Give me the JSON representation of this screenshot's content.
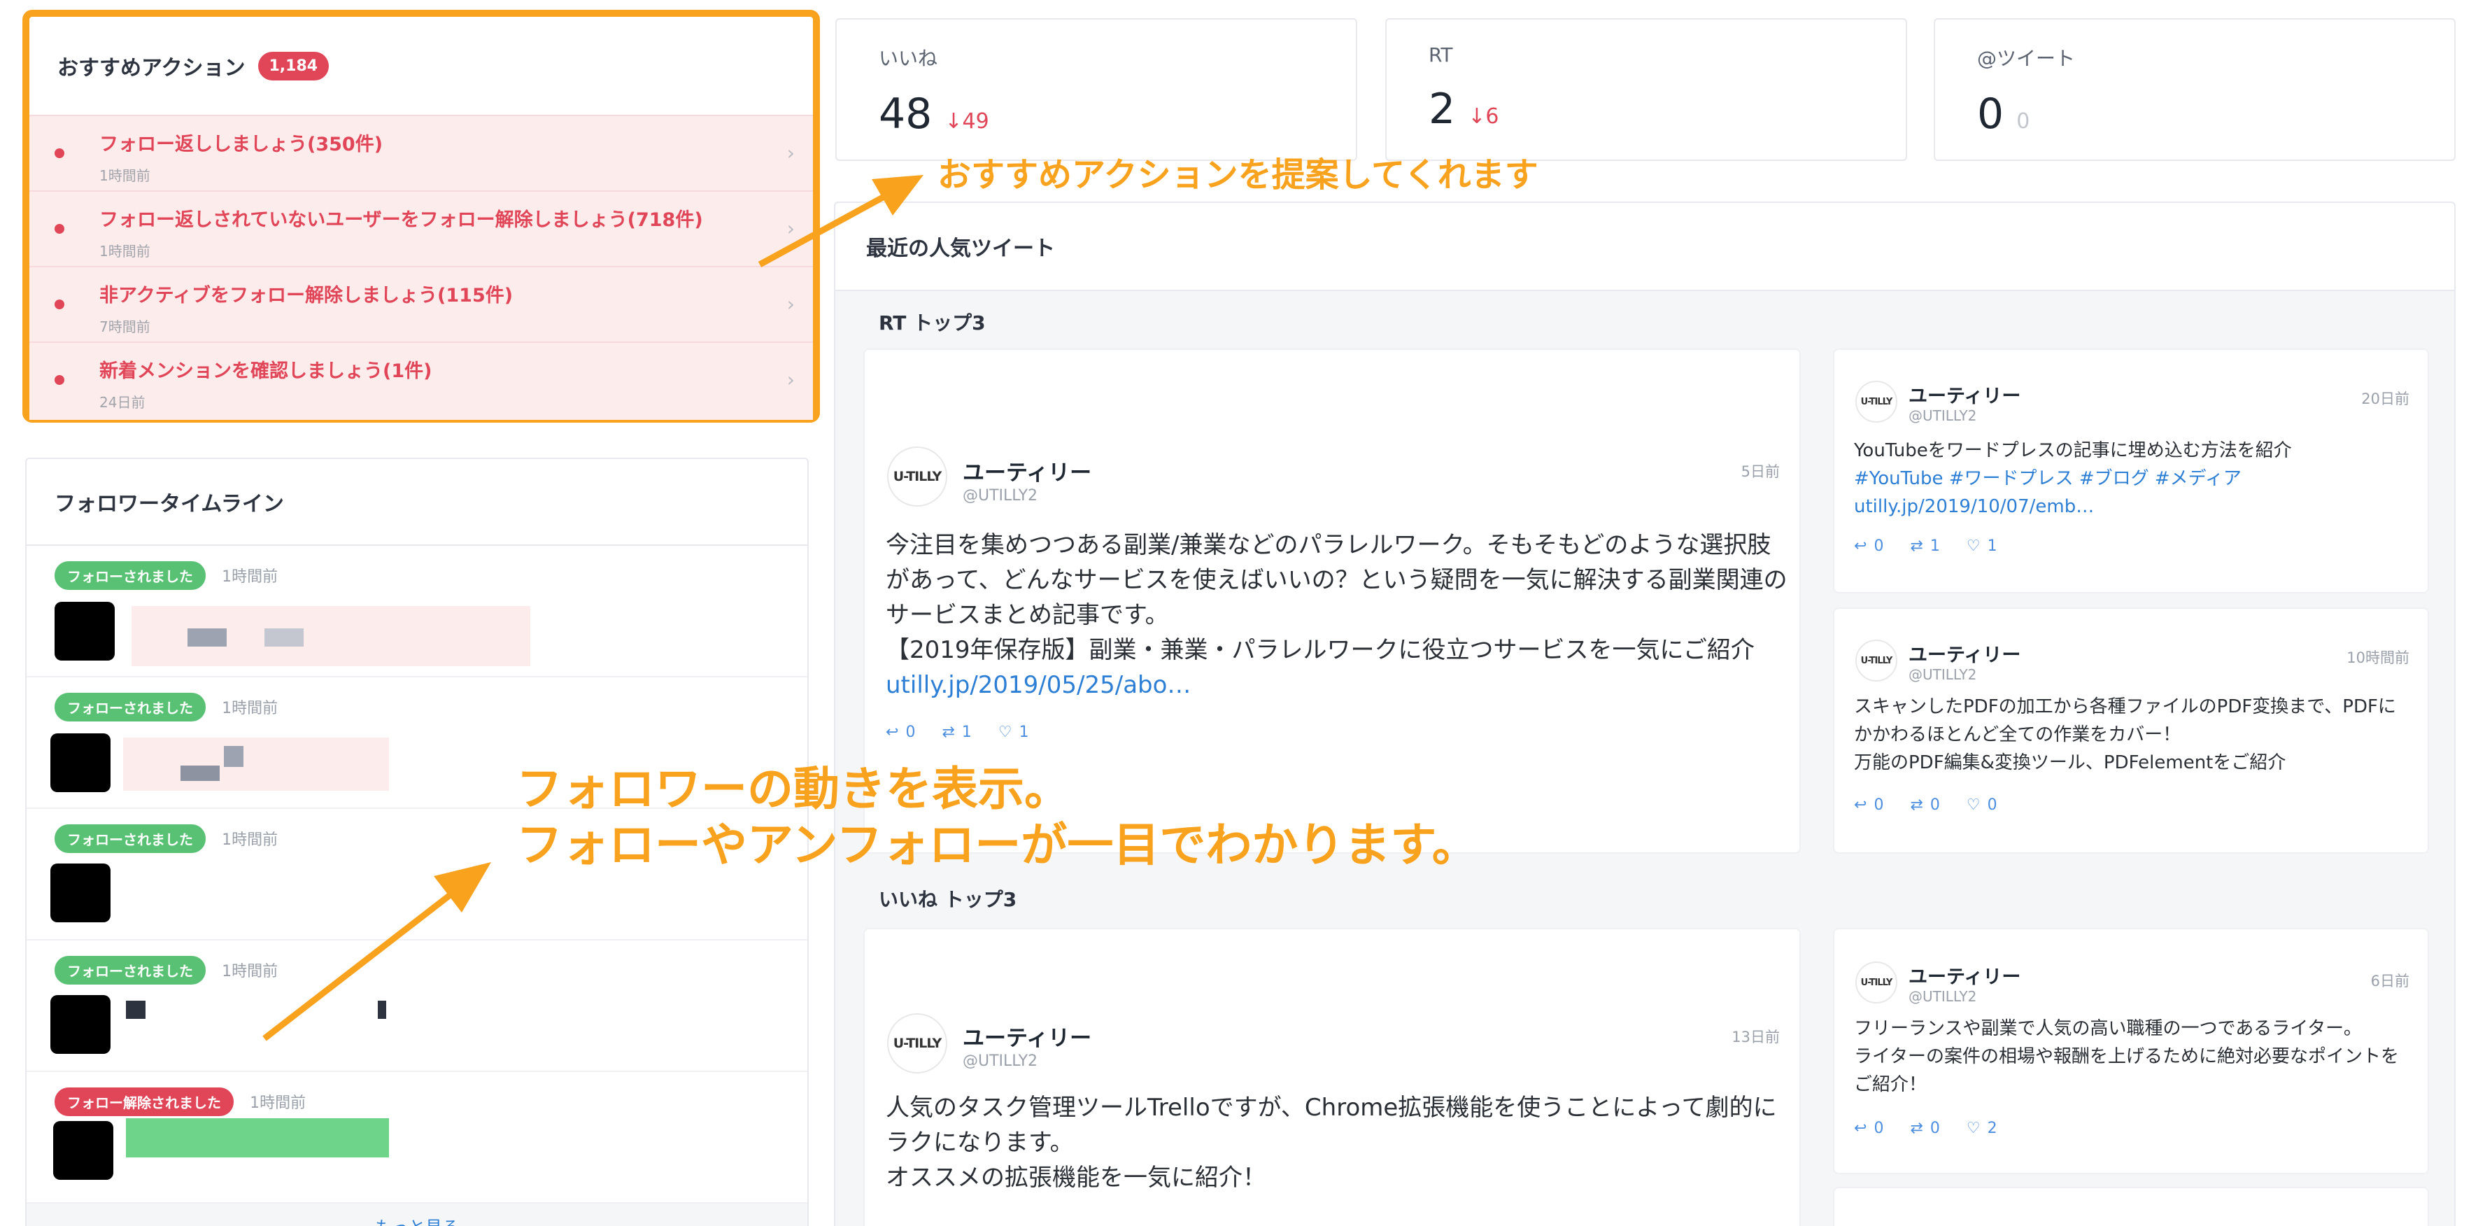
{
  "recommended": {
    "title": "おすすめアクション",
    "count": "1,184",
    "items": [
      {
        "label": "フォロー返ししましょう(350件)",
        "time": "1時間前"
      },
      {
        "label": "フォロー返しされていないユーザーをフォロー解除しましょう(718件)",
        "time": "1時間前"
      },
      {
        "label": "非アクティブをフォロー解除しましょう(115件)",
        "time": "7時間前"
      },
      {
        "label": "新着メンションを確認しましょう(1件)",
        "time": "24日前"
      }
    ]
  },
  "timeline": {
    "title": "フォロワータイムライン",
    "items": [
      {
        "tag": "フォローされました",
        "time": "1時間前"
      },
      {
        "tag": "フォローされました",
        "time": "1時間前"
      },
      {
        "tag": "フォローされました",
        "time": "1時間前"
      },
      {
        "tag": "フォローされました",
        "time": "1時間前"
      },
      {
        "tag": "フォロー解除されました",
        "time": "1時間前"
      }
    ],
    "more": "もっと見る"
  },
  "stats": [
    {
      "label": "いいね",
      "value": "48",
      "delta": "↓49"
    },
    {
      "label": "RT",
      "value": "2",
      "delta": "↓6"
    },
    {
      "label": "@ツイート",
      "value": "0",
      "delta": "0"
    }
  ],
  "popular": {
    "title": "最近の人気ツイート",
    "rt_top": "RT トップ3",
    "like_top": "いいね トップ3",
    "logo": "U-TILLY",
    "tweets": [
      {
        "name": "ユーティリー",
        "handle": "@UTILLY2",
        "date": "5日前",
        "text": "今注目を集めつつある副業/兼業などのパラレルワーク。そもそもどのような選択肢があって、どんなサービスを使えばいいの？という疑問を一気に解決する副業関連のサービスまとめ記事です。\n【2019年保存版】副業・兼業・パラレルワークに役立つサービスを一気にご紹介 ",
        "link": "utilly.jp/2019/05/25/abo…",
        "reply": "0",
        "rt": "1",
        "like": "1"
      },
      {
        "name": "ユーティリー",
        "handle": "@UTILLY2",
        "date": "20日前",
        "text": "YouTubeをワードプレスの記事に埋め込む方法を紹介",
        "link": "#YouTube #ワードプレス #ブログ #メディア\nutilly.jp/2019/10/07/emb…",
        "reply": "0",
        "rt": "1",
        "like": "1"
      },
      {
        "name": "ユーティリー",
        "handle": "@UTILLY2",
        "date": "10時間前",
        "text": "スキャンしたPDFの加工から各種ファイルのPDF変換まで、PDFにかかわるほとんど全ての作業をカバー！\n万能のPDF編集&変換ツール、PDFelementをご紹介",
        "reply": "0",
        "rt": "0",
        "like": "0"
      },
      {
        "name": "ユーティリー",
        "handle": "@UTILLY2",
        "date": "13日前",
        "text": "人気のタスク管理ツールTrelloですが、Chrome拡張機能を使うことによって劇的にラクになります。\nオススメの拡張機能を一気に紹介！"
      },
      {
        "name": "ユーティリー",
        "handle": "@UTILLY2",
        "date": "6日前",
        "text": "フリーランスや副業で人気の高い職種の一つであるライター。\nライターの案件の相場や報酬を上げるために絶対必要なポイントをご紹介！",
        "reply": "0",
        "rt": "0",
        "like": "2"
      }
    ]
  },
  "annotations": {
    "top": "おすすめアクションを提案してくれます",
    "line1": "フォロワーの動きを表示。",
    "line2": "フォローやアンフォローが一目でわかります。"
  },
  "colors": {
    "accent": "#f8a21e",
    "alert": "#e04658",
    "follow": "#59c173",
    "link": "#2d7fd5"
  }
}
